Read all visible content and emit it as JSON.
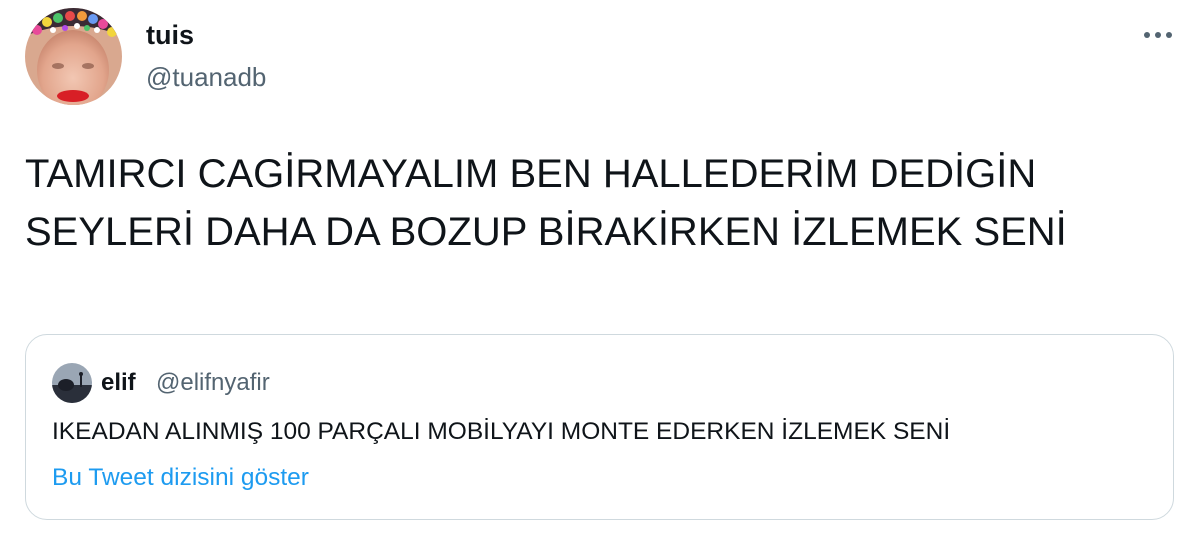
{
  "tweet": {
    "author": {
      "name": "tuis",
      "handle": "@tuanadb",
      "avatar_icon": "profile-photo-with-flower-crown"
    },
    "more_icon": "ellipsis-icon",
    "text": "TAMIRCI CAGİRMAYALIM BEN HALLEDERİM DEDİGİN SEYLERİ DAHA DA BOZUP BİRAKİRKEN İZLEMEK SENİ",
    "quoted": {
      "author": {
        "name": "elif",
        "handle": "@elifnyafir",
        "avatar_icon": "profile-photo-dark"
      },
      "text": "IKEADAN ALINMIŞ 100 PARÇALI MOBİLYAYI MONTE EDERKEN İZLEMEK SENİ",
      "show_thread_link": "Bu Tweet dizisini göster"
    }
  },
  "colors": {
    "primary_text": "#0f1419",
    "secondary_text": "#536471",
    "link": "#1d9bf0",
    "border": "#cfd9de"
  }
}
